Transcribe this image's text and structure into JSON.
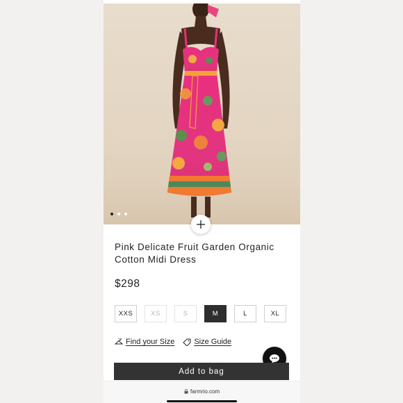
{
  "product": {
    "title": "Pink Delicate Fruit Garden Organic Cotton Midi Dress",
    "price": "$298",
    "image_alt": "model wearing pink floral midi dress",
    "gallery": {
      "count": 3,
      "active": 1
    }
  },
  "sizes": [
    {
      "label": "XXS",
      "state": "available"
    },
    {
      "label": "XS",
      "state": "unavailable"
    },
    {
      "label": "S",
      "state": "unavailable"
    },
    {
      "label": "M",
      "state": "selected"
    },
    {
      "label": "L",
      "state": "available"
    },
    {
      "label": "XL",
      "state": "available"
    }
  ],
  "links": {
    "find_size": "Find your Size",
    "size_guide": "Size Guide"
  },
  "actions": {
    "add_to_bag": "Add to bag"
  },
  "browser": {
    "url": "farmrio.com"
  },
  "icons": {
    "zoom": "plus-icon",
    "find_size": "hanger-icon",
    "size_guide": "tag-icon",
    "chat": "chat-bubble-icon",
    "url": "lock-icon"
  },
  "colors": {
    "selected_size": "#2e2e2e",
    "primary_button": "#333333",
    "page_background": "#f2f1ef"
  }
}
